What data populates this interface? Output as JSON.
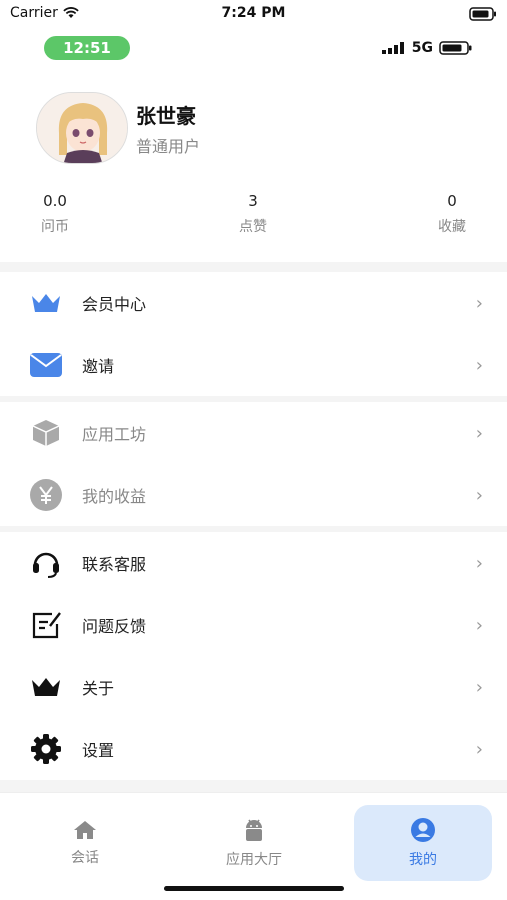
{
  "status_bar": {
    "carrier": "Carrier",
    "time": "7:24 PM"
  },
  "inner_status": {
    "time": "12:51",
    "network": "5G"
  },
  "profile": {
    "name": "张世豪",
    "role": "普通用户"
  },
  "stats": [
    {
      "value": "0.0",
      "label": "问币"
    },
    {
      "value": "3",
      "label": "点赞"
    },
    {
      "value": "0",
      "label": "收藏"
    }
  ],
  "menu": {
    "vip_center": "会员中心",
    "invite": "邀请",
    "app_workshop": "应用工坊",
    "my_earnings": "我的收益",
    "contact_support": "联系客服",
    "feedback": "问题反馈",
    "about": "关于",
    "settings": "设置"
  },
  "tabbar": {
    "chat": "会话",
    "app_hall": "应用大厅",
    "mine": "我的"
  },
  "colors": {
    "accent": "#3a7ae3",
    "pill": "#5cc768",
    "active_tab_bg": "#dbe9fb"
  }
}
